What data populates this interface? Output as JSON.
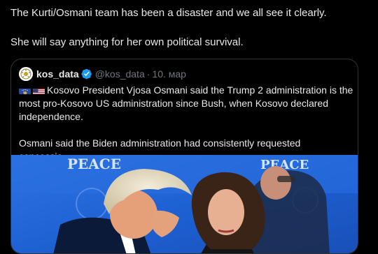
{
  "tweet": {
    "line1": "The Kurti/Osmani team has been a disaster and we all see it clearly.",
    "line2": "She will say anything for her own political survival."
  },
  "quote": {
    "avatar_icon": "kos-data-logo-icon",
    "author_name": "kos_data",
    "verified_icon": "verified-badge-icon",
    "handle": "@kos_data",
    "separator": "·",
    "date": "10. мар",
    "flags": [
      "kosovo-flag-icon",
      "us-flag-icon"
    ],
    "paragraph1_line1": "Kosovo President Vjosa Osmani said the Trump 2 administration is the",
    "paragraph1_line2": "most pro-Kosovo US administration since Bush, when Kosovo declared",
    "paragraph1_line3": "independence.",
    "paragraph2": "Osmani said the Biden administration had consistently requested concessio...",
    "media": {
      "banner_text_left": "PEACE",
      "banner_text_right": "PEACE",
      "background_color": "#1f63d6"
    }
  }
}
